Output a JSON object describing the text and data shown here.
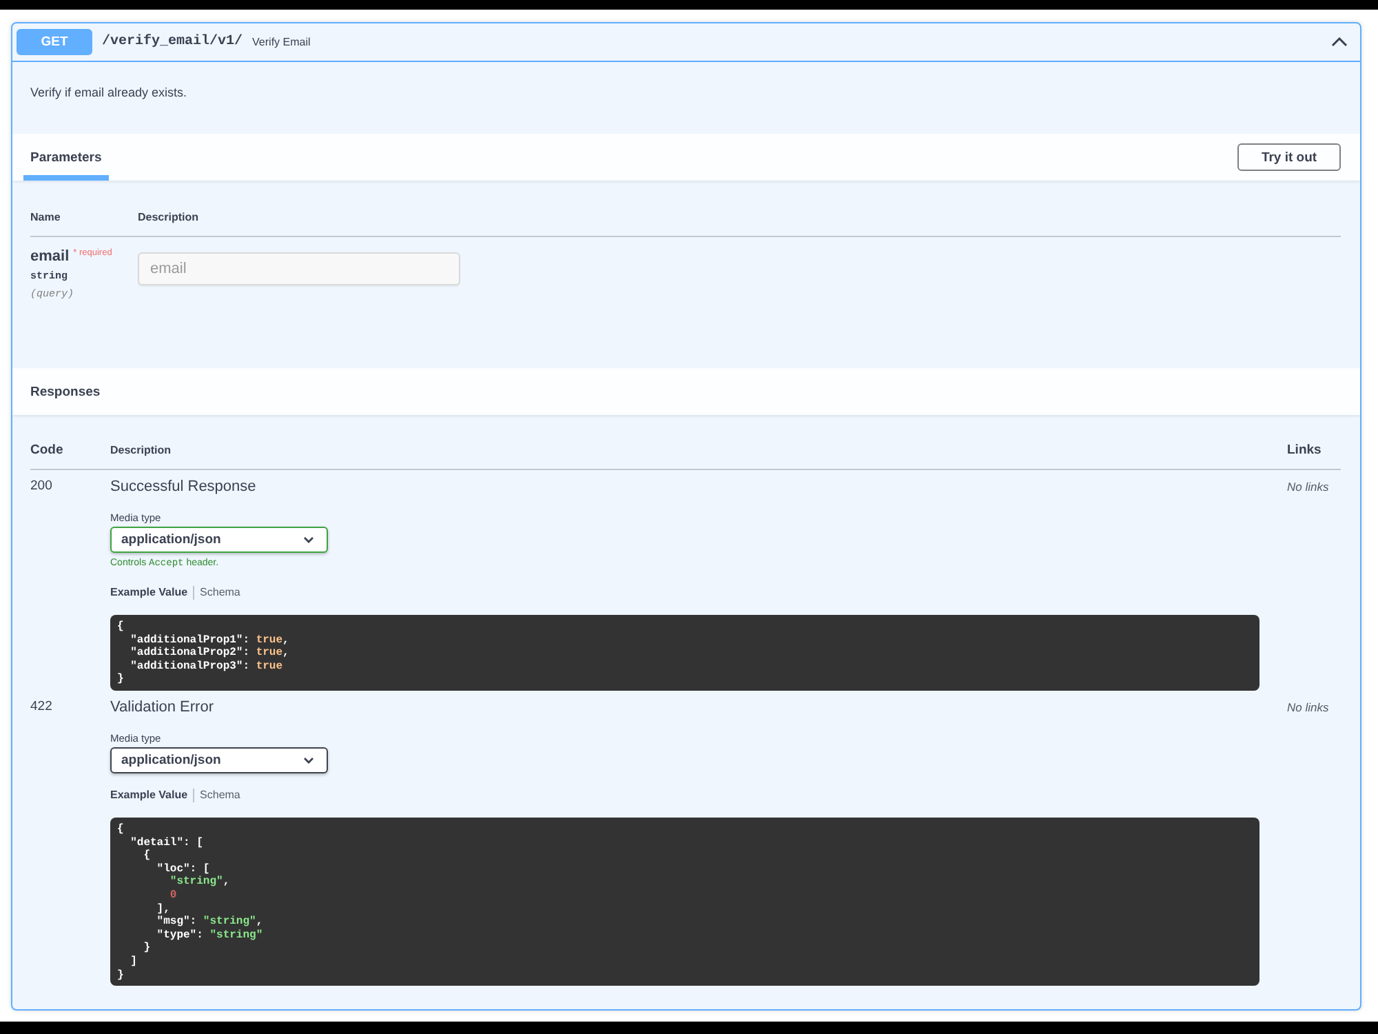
{
  "operation": {
    "method": "GET",
    "path": "/verify_email/v1/",
    "summary": "Verify Email",
    "expanded": true,
    "description": "Verify if email already exists."
  },
  "parameters": {
    "tabs": [
      {
        "label": "Parameters",
        "selected": true
      }
    ],
    "try_button": "Try it out",
    "columns": [
      "Name",
      "Description"
    ],
    "rows": [
      {
        "name": "email",
        "required": true,
        "required_label": "* required",
        "type": "string",
        "location": "(query)",
        "placeholder": "email"
      }
    ]
  },
  "responses": {
    "title": "Responses",
    "columns": [
      "Code",
      "Description",
      "Links"
    ],
    "rows": [
      {
        "code": "200",
        "description": "Successful Response",
        "media_type_label": "Media type",
        "media_type": "application/json",
        "controls_accept": true,
        "accept_hint": [
          {
            "kind": "text",
            "text": "Controls"
          },
          {
            "kind": "code",
            "text": "Accept"
          },
          {
            "kind": "text",
            "text": "header."
          }
        ],
        "example_tabs": [
          {
            "label": "Example Value",
            "selected": true
          },
          {
            "label": "Schema",
            "selected": false
          }
        ],
        "example": [
          {
            "tokens": [
              {
                "kind": "plain",
                "text": "{"
              }
            ]
          },
          {
            "tokens": [
              {
                "kind": "plain",
                "text": "  \"additionalProp1\": "
              },
              {
                "kind": "boolean",
                "text": "true"
              },
              {
                "kind": "plain",
                "text": ","
              }
            ]
          },
          {
            "tokens": [
              {
                "kind": "plain",
                "text": "  \"additionalProp2\": "
              },
              {
                "kind": "boolean",
                "text": "true"
              },
              {
                "kind": "plain",
                "text": ","
              }
            ]
          },
          {
            "tokens": [
              {
                "kind": "plain",
                "text": "  \"additionalProp3\": "
              },
              {
                "kind": "boolean",
                "text": "true"
              }
            ]
          },
          {
            "tokens": [
              {
                "kind": "plain",
                "text": "}"
              }
            ]
          }
        ],
        "links": "No links"
      },
      {
        "code": "422",
        "description": "Validation Error",
        "media_type_label": "Media type",
        "media_type": "application/json",
        "controls_accept": false,
        "example_tabs": [
          {
            "label": "Example Value",
            "selected": true
          },
          {
            "label": "Schema",
            "selected": false
          }
        ],
        "example": [
          {
            "tokens": [
              {
                "kind": "plain",
                "text": "{"
              }
            ]
          },
          {
            "tokens": [
              {
                "kind": "plain",
                "text": "  \"detail\": ["
              }
            ]
          },
          {
            "tokens": [
              {
                "kind": "plain",
                "text": "    {"
              }
            ]
          },
          {
            "tokens": [
              {
                "kind": "plain",
                "text": "      \"loc\": ["
              }
            ]
          },
          {
            "tokens": [
              {
                "kind": "string",
                "text": "        \"string\""
              },
              {
                "kind": "plain",
                "text": ","
              }
            ]
          },
          {
            "tokens": [
              {
                "kind": "number",
                "text": "        0"
              }
            ]
          },
          {
            "tokens": [
              {
                "kind": "plain",
                "text": "      ],"
              }
            ]
          },
          {
            "tokens": [
              {
                "kind": "plain",
                "text": "      \"msg\": "
              },
              {
                "kind": "string",
                "text": "\"string\""
              },
              {
                "kind": "plain",
                "text": ","
              }
            ]
          },
          {
            "tokens": [
              {
                "kind": "plain",
                "text": "      \"type\": "
              },
              {
                "kind": "string",
                "text": "\"string\""
              }
            ]
          },
          {
            "tokens": [
              {
                "kind": "plain",
                "text": "    }"
              }
            ]
          },
          {
            "tokens": [
              {
                "kind": "plain",
                "text": "  ]"
              }
            ]
          },
          {
            "tokens": [
              {
                "kind": "plain",
                "text": "}"
              }
            ]
          }
        ],
        "links": "No links"
      }
    ]
  }
}
